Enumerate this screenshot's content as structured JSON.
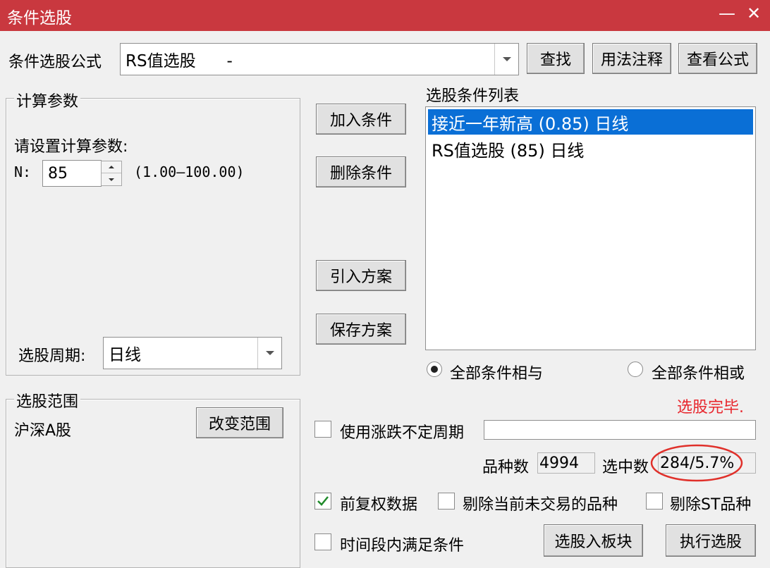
{
  "window": {
    "title": "条件选股",
    "minimize_glyph": "—",
    "close_glyph": "✕"
  },
  "formula": {
    "label": "条件选股公式",
    "value": "RS值选股      -",
    "buttons": {
      "find": "查找",
      "usage": "用法注释",
      "view": "查看公式"
    }
  },
  "params": {
    "group_title": "计算参数",
    "prompt": "请设置计算参数:",
    "n_label": "N:",
    "n_value": "85",
    "n_range": "(1.00—100.00)",
    "period_label": "选股周期:",
    "period_value": "日线"
  },
  "range": {
    "group_title": "选股范围",
    "value": "沪深A股",
    "change_button": "改变范围"
  },
  "actions": {
    "add": "加入条件",
    "delete": "删除条件",
    "import": "引入方案",
    "save": "保存方案"
  },
  "conditions": {
    "title": "选股条件列表",
    "items": [
      {
        "label": "接近一年新高 (0.85) 日线",
        "selected": true
      },
      {
        "label": "RS值选股 (85) 日线",
        "selected": false
      }
    ],
    "logic_and": "全部条件相与",
    "logic_or": "全部条件相或",
    "logic_selected": "and"
  },
  "status": {
    "text": "选股完毕.",
    "color": "#e8262d"
  },
  "options": {
    "irregular_period": "使用涨跌不定周期",
    "irregular_period_checked": false,
    "prior_adjust": "前复权数据",
    "prior_adjust_checked": true,
    "exclude_untraded": "剔除当前未交易的品种",
    "exclude_untraded_checked": false,
    "exclude_st": "剔除ST品种",
    "exclude_st_checked": false,
    "time_window": "时间段内满足条件",
    "time_window_checked": false
  },
  "stats": {
    "count_label": "品种数",
    "count_value": "4994",
    "selected_label": "选中数",
    "selected_value": "284/5.7%",
    "highlight_color": "#e0302a"
  },
  "footer": {
    "to_block": "选股入板块",
    "execute": "执行选股"
  },
  "colors": {
    "titlebar": "#c9383f",
    "selection": "#0a6fd6",
    "check": "#1f8a2a"
  }
}
